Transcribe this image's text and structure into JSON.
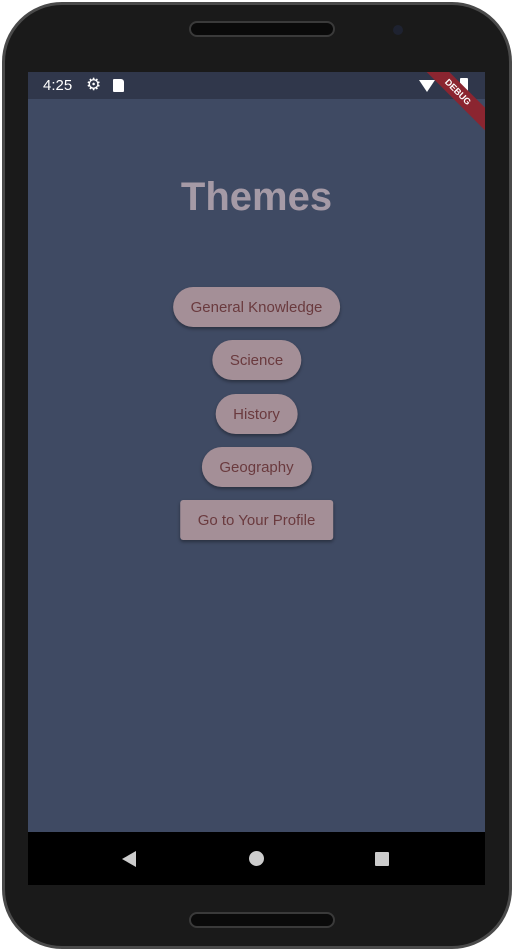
{
  "status_bar": {
    "time": "4:25",
    "icons": [
      "gear-icon",
      "sd-card-icon",
      "wifi-icon",
      "signal-icon",
      "battery-icon"
    ]
  },
  "debug_banner": "DEBUG",
  "page": {
    "title": "Themes"
  },
  "buttons": [
    {
      "label": "General Knowledge"
    },
    {
      "label": "Science"
    },
    {
      "label": "History"
    },
    {
      "label": "Geography"
    },
    {
      "label": "Go to Your Profile"
    }
  ],
  "colors": {
    "background": "#3f4a63",
    "status_bar": "#30374b",
    "title": "#a59aa6",
    "button_bg": "#a48f97",
    "button_text": "#6a3a3e",
    "debug": "#8b2530"
  }
}
